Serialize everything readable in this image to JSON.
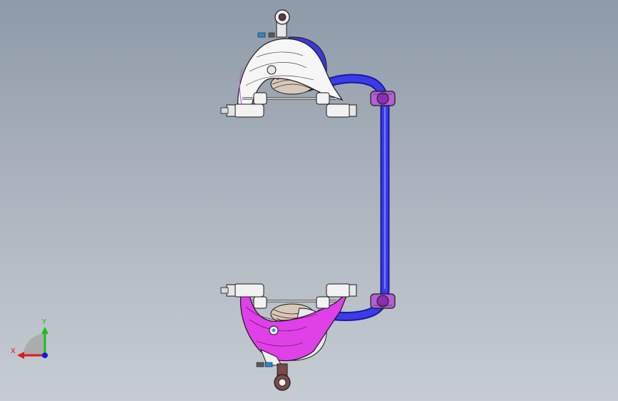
{
  "viewport": {
    "description_free": true,
    "colors": {
      "background_top": "#8e9aa8",
      "background_bottom": "#c6ccd2",
      "anti_roll_bar": "#2a2ad0",
      "upper_arm_top": "#f4f4f4",
      "upper_arm_bottom": "#e040e0",
      "bushing": "#b060d0",
      "spring": "#d8c8b8",
      "edge": "#1a1a1a"
    }
  },
  "triad": {
    "x_label": "X",
    "y_label": "Y",
    "x_color": "#e01818",
    "y_color": "#18c018",
    "z_color": "#1818e0"
  }
}
